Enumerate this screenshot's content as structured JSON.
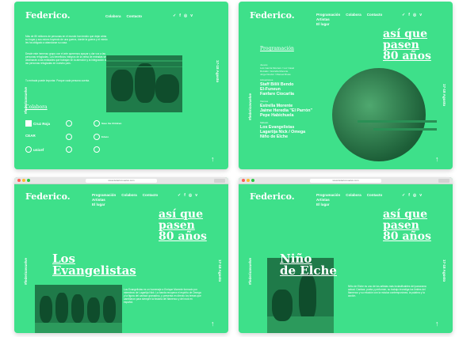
{
  "brand": "Federico.",
  "nav": {
    "programacion": "Programación",
    "artistas": "Artistas",
    "el_lugar": "El lugar",
    "colabora": "Colabora",
    "contacto": "Contacto"
  },
  "social_icons": [
    "twitter-icon",
    "facebook-icon",
    "instagram-icon",
    "vimeo-icon"
  ],
  "social_glyphs": [
    "✓",
    "f",
    "◎",
    "v"
  ],
  "hashtag": "#federicovuelve",
  "dates": "17-18 Agosto",
  "tagline": {
    "line1": "así que",
    "line2": "pasen",
    "line3": "80 años"
  },
  "panel1": {
    "paragraph1": "Más de 80 millones de personas en el mundo han tenido que dejar atrás su hogar y sus raíces huyendo de una guerra, donde la guerra y el miedo les ha obligado a abandonar su casa.",
    "paragraph2": "Desde este inmenso grupo con el arte queremos apoyar y dar voz a las personas refugiadas. Los beneficios íntegros de la venta de entradas se destinarán a las entidades que trabajan en la atención y la integración de las personas refugiadas en nuestro país.",
    "paragraph3": "Tu entrada puede importar. Porque cada persona cuenta.",
    "colabora_title": "Colabora",
    "partners": [
      "Cruz Roja",
      "Save the Children",
      "CEAR",
      "Asociación",
      "Médicos del Mundo",
      "Educo",
      "unicef",
      "ACNUR",
      "MSF"
    ]
  },
  "panel2": {
    "section_title": "Programación",
    "blocks": [
      {
        "time": "Jueves",
        "names": [
          "Luis García Montero / Luz Casal",
          "Rozalén / Estrella Morente",
          "Jorge Drexler / Manuel Rivas"
        ]
      },
      {
        "time": "Actuaciones",
        "names": [
          "Staff Bililí Bendo",
          "El-Funeun",
          "Fanfare Ciocarlia"
        ]
      },
      {
        "time": "Viernes",
        "names": [
          "Estrella Morente",
          "Jaime Heredia \"El Parrón\"",
          "Pepe Habichuela"
        ]
      },
      {
        "time": "Sábado",
        "names": [
          "Los Evangelistas",
          "Lagartija Nick / Omega",
          "Niño de Elche"
        ]
      }
    ]
  },
  "panel3": {
    "browser_url": "www.federicovuelve.com",
    "artist_title_1": "Los",
    "artist_title_2": "Evangelistas",
    "bio": "Los Evangelistas es un homenaje a Enrique Morente formado por miembros de Lagartija Nick. La banda recupera el espíritu de Omega y la figura del cantaor granadino, y presenta en directo los temas que cambiaron para siempre la historia del flamenco y del rock en español."
  },
  "panel4": {
    "browser_url": "www.federicovuelve.com",
    "artist_title_1": "Niño",
    "artist_title_2": "de Elche",
    "bio": "Niño de Elche es uno de los artistas más inclasificables del panorama actual. Cantaor, poeta y performer, su trabajo investiga los límites del flamenco y su relación con la música contemporánea, la palabra y la acción."
  },
  "colors": {
    "background": "#3ee08a",
    "photo": "#1f7a49",
    "text": "#ffffff"
  }
}
